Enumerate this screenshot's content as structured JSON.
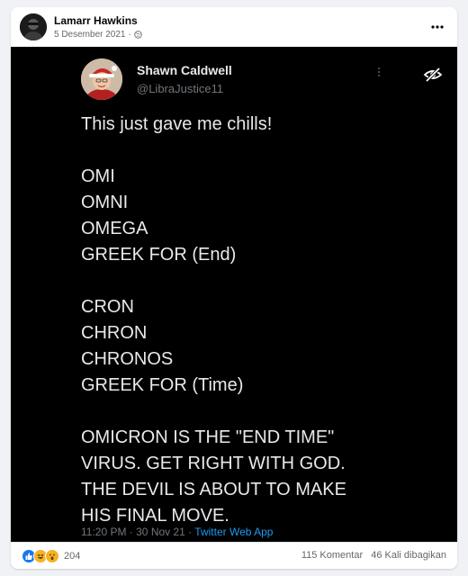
{
  "post": {
    "author": "Lamarr Hawkins",
    "date": "5 Desember 2021",
    "separator": "·",
    "privacy_icon": "globe-icon",
    "more_icon": "ellipsis-icon"
  },
  "tweet": {
    "name": "Shawn Caldwell",
    "handle": "@LibraJustice11",
    "body_lines": [
      "This just gave me chills!",
      "",
      "OMI",
      "OMNI",
      "OMEGA",
      "GREEK FOR (End)",
      "",
      "CRON",
      "CHRON",
      "CHRONOS",
      "GREEK FOR (Time)",
      "",
      "OMICRON IS THE \"END TIME\"",
      "VIRUS. GET RIGHT WITH GOD.",
      "THE DEVIL IS ABOUT TO MAKE",
      "HIS FINAL MOVE."
    ],
    "footer_time": "11:20 PM · 30 Nov 21 · ",
    "footer_app": "Twitter Web App"
  },
  "overlay": {
    "hide_icon": "eye-slash-icon"
  },
  "stats": {
    "reaction_icons": [
      "like-icon",
      "haha-icon",
      "wow-icon"
    ],
    "reaction_count": "204",
    "comments": "115 Komentar",
    "shares": "46 Kali dibagikan"
  },
  "colors": {
    "page_bg": "#f0f2f5",
    "media_bg": "#000000",
    "tweet_text": "#e7e9ea",
    "tweet_handle": "#71767b",
    "like_blue": "#1877f2",
    "reaction_yellow": "#f7b125"
  }
}
